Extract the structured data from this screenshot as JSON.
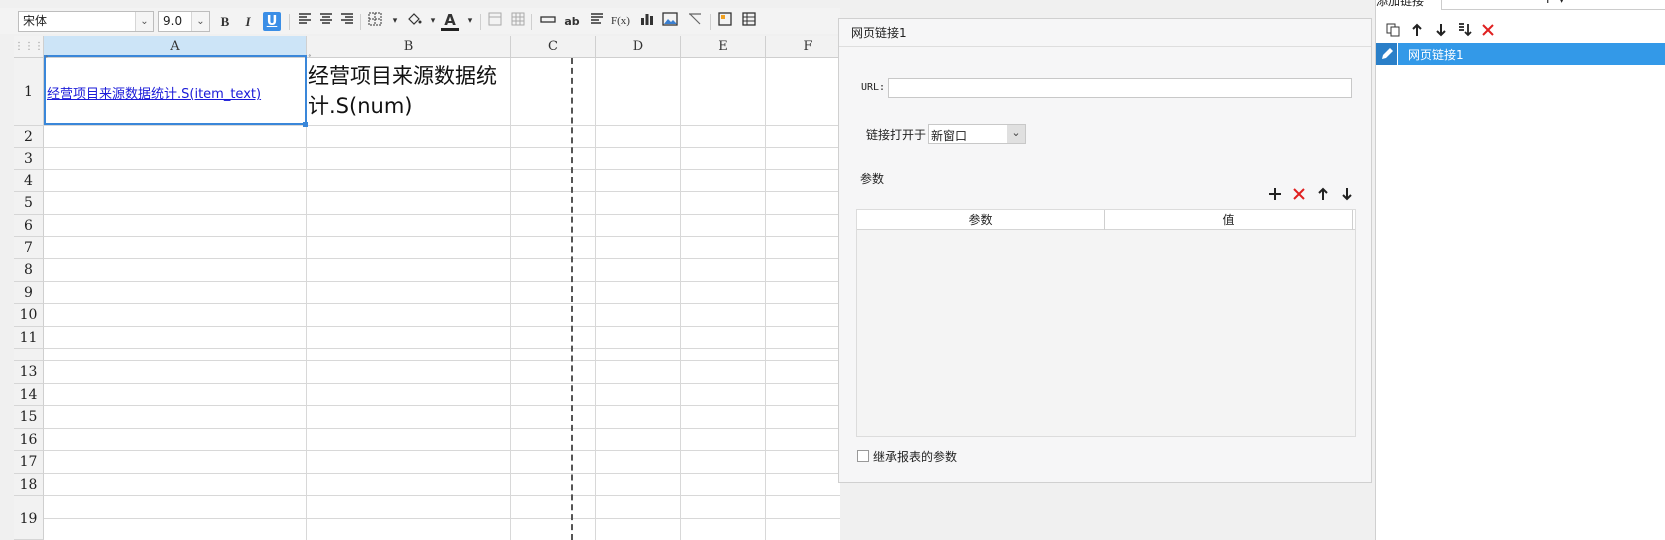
{
  "toolbar": {
    "font_name": "宋体",
    "font_size": "9.0",
    "bold_label": "B",
    "italic_label": "I",
    "underline_label": "U",
    "font_color_label": "A",
    "wrap_label": "ab",
    "formula_label": "F(x)"
  },
  "sheet": {
    "columns": [
      "A",
      "B",
      "C",
      "D",
      "E",
      "F"
    ],
    "rows": [
      "1",
      "2",
      "3",
      "4",
      "5",
      "6",
      "7",
      "8",
      "9",
      "10",
      "11",
      "13",
      "14",
      "15",
      "16",
      "17",
      "18",
      "19"
    ],
    "cell_a1": "经营项目来源数据统计.S(item_text)",
    "cell_b1": "经营项目来源数据统计.S(num)"
  },
  "dialog": {
    "title": "网页链接1",
    "url_label": "URL:",
    "url_value": "",
    "open_in_label": "链接打开于",
    "open_in_value": "新窗口",
    "params_label": "参数",
    "params_table": {
      "headers": [
        "参数",
        "值"
      ]
    },
    "inherit_label": "继承报表的参数",
    "inherit_checked": false
  },
  "right_panel": {
    "header_label": "添加链接",
    "items": [
      "网页链接1"
    ]
  },
  "colors": {
    "accent": "#3399e8",
    "link": "#1a1ad8",
    "delete": "#e02020",
    "selection_border": "#3a87d9"
  },
  "icons": [
    "copy-icon",
    "move-up-icon",
    "move-down-icon",
    "move-bottom-icon",
    "delete-icon",
    "add-icon",
    "pencil-icon"
  ]
}
